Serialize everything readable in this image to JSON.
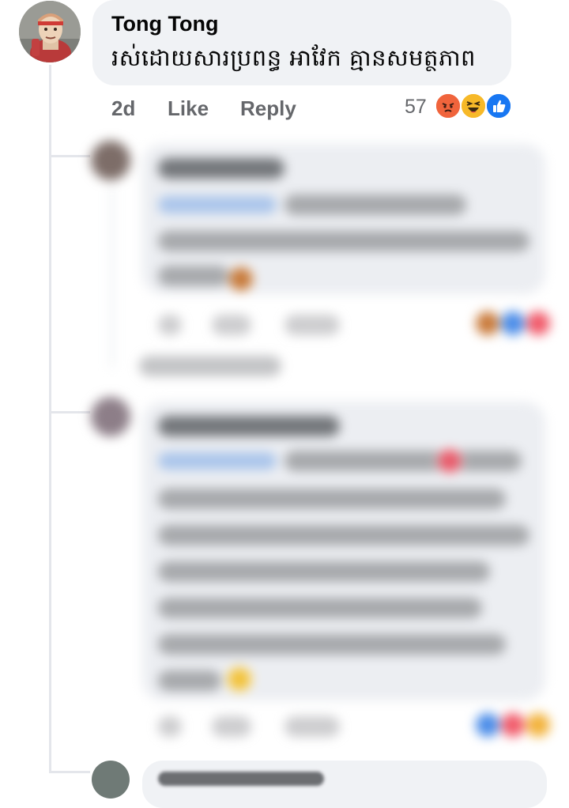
{
  "comment": {
    "author": "Tong Tong",
    "text": "រស់ដោយសារប្រពន្ធ  អាវែក គ្មានសមត្ថភាព",
    "time": "2d",
    "like_label": "Like",
    "reply_label": "Reply",
    "reaction_count": "57",
    "reactions": [
      "angry-reaction-icon",
      "haha-reaction-icon",
      "like-reaction-icon"
    ]
  },
  "colors": {
    "bubble": "#f0f2f5",
    "meta_text": "#65676b",
    "like_blue": "#1877f2",
    "angry_orange": "#f0643c",
    "haha_yellow": "#f7b928"
  }
}
